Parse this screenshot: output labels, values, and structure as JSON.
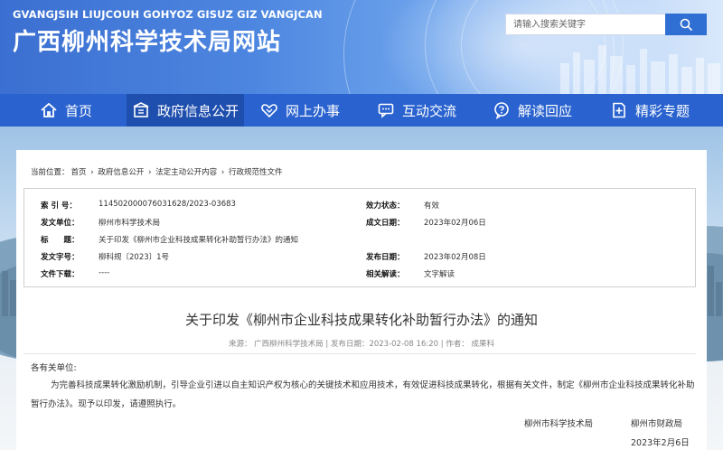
{
  "header": {
    "pinyin": "GVANGJSIH LIUJCOUH GOHYOZ GISUZ GIZ VANGJCAN",
    "title": "广西柳州科学技术局网站",
    "search_placeholder": "请输入搜索关键字",
    "search_icon": "search-icon"
  },
  "nav": {
    "items": [
      {
        "label": "首页",
        "icon": "home-icon"
      },
      {
        "label": "政府信息公开",
        "icon": "building-icon"
      },
      {
        "label": "网上办事",
        "icon": "handshake-icon"
      },
      {
        "label": "互动交流",
        "icon": "chat-icon"
      },
      {
        "label": "解读回应",
        "icon": "qa-icon"
      },
      {
        "label": "精彩专题",
        "icon": "plus-doc-icon"
      }
    ],
    "active_index": 1
  },
  "breadcrumb": {
    "prefix": "当前位置：",
    "items": [
      "首页",
      "政府信息公开",
      "法定主动公开内容",
      "行政规范性文件"
    ],
    "separator": "›"
  },
  "meta": {
    "index_label": "索 引 号：",
    "index_value": "114502000076031628/2023-03683",
    "status_label": "效力状态：",
    "status_value": "有效",
    "issuer_label": "发文单位：",
    "issuer_value": "柳州市科学技术局",
    "created_label": "成文日期：",
    "created_value": "2023年02月06日",
    "title_label": "标　　题：",
    "title_value": "关于印发《柳州市企业科技成果转化补助暂行办法》的通知",
    "docno_label": "发文字号：",
    "docno_value": "柳科规〔2023〕1号",
    "published_label": "发布日期：",
    "published_value": "2023年02月08日",
    "download_label": "文件下载：",
    "download_value": "----",
    "interp_label": "相关解读：",
    "interp_value": "文字解读"
  },
  "document": {
    "title": "关于印发《柳州市企业科技成果转化补助暂行办法》的通知",
    "source_line": "来源： 广西柳州科学技术局  |  发布日期：2023-02-08 16:20  |  作者： 成果科",
    "salutation": "各有关单位:",
    "paragraph": "为完善科技成果转化激励机制，引导企业引进以自主知识产权为核心的关键技术和应用技术，有效促进科技成果转化，根据有关文件，制定《柳州市企业科技成果转化补助暂行办法》。现予以印发，请遵照执行。",
    "signer_1": "柳州市科学技术局",
    "signer_2": "柳州市财政局",
    "date": "2023年2月6日"
  },
  "colors": {
    "nav_bg": "#2a63cf",
    "nav_active": "#1f4fae",
    "search_button": "#2f6fd4"
  }
}
